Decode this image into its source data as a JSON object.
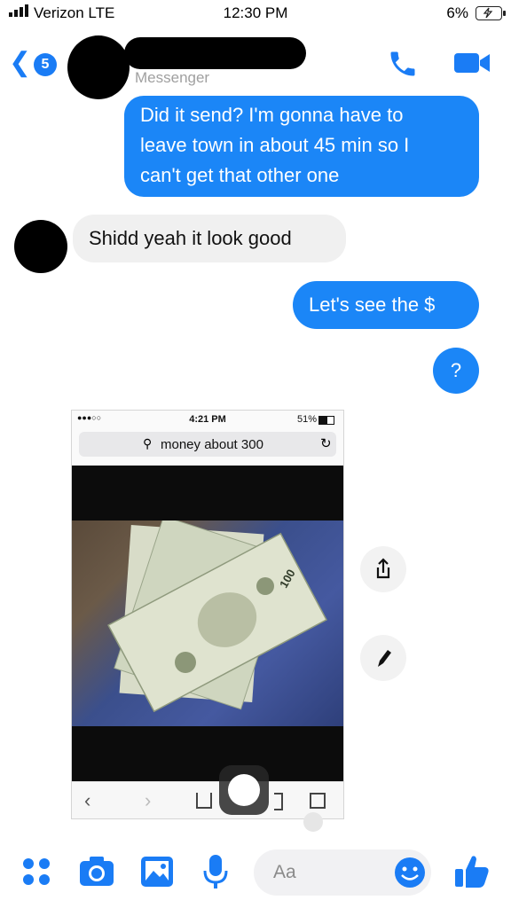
{
  "status_bar": {
    "carrier": "Verizon LTE",
    "time": "12:30 PM",
    "battery": "6%"
  },
  "header": {
    "subtitle": "Messenger",
    "back_count": "5"
  },
  "messages": [
    {
      "sender": "me",
      "lines": [
        "Did it send? I'm gonna have to",
        "leave town in about 45 min so I",
        "can't get that other one"
      ]
    },
    {
      "sender": "them",
      "text": "Shidd yeah it look good"
    },
    {
      "sender": "me",
      "text": "Let's see the $"
    },
    {
      "sender": "me",
      "text": "?"
    }
  ],
  "shared_image": {
    "time": "4:21 PM",
    "battery": "51%",
    "search_query": "money about 300",
    "bill_value": "100"
  },
  "composer": {
    "placeholder": "Aa"
  },
  "colors": {
    "accent": "#1a7cf5",
    "bubble_out": "#1b86f7",
    "bubble_in": "#f0f0f0"
  },
  "icons": [
    "signal-icon",
    "battery-icon",
    "back-chevron-icon",
    "phone-icon",
    "video-icon",
    "share-icon",
    "edit-icon",
    "apps-icon",
    "camera-icon",
    "image-icon",
    "microphone-icon",
    "emoji-icon",
    "like-icon"
  ]
}
